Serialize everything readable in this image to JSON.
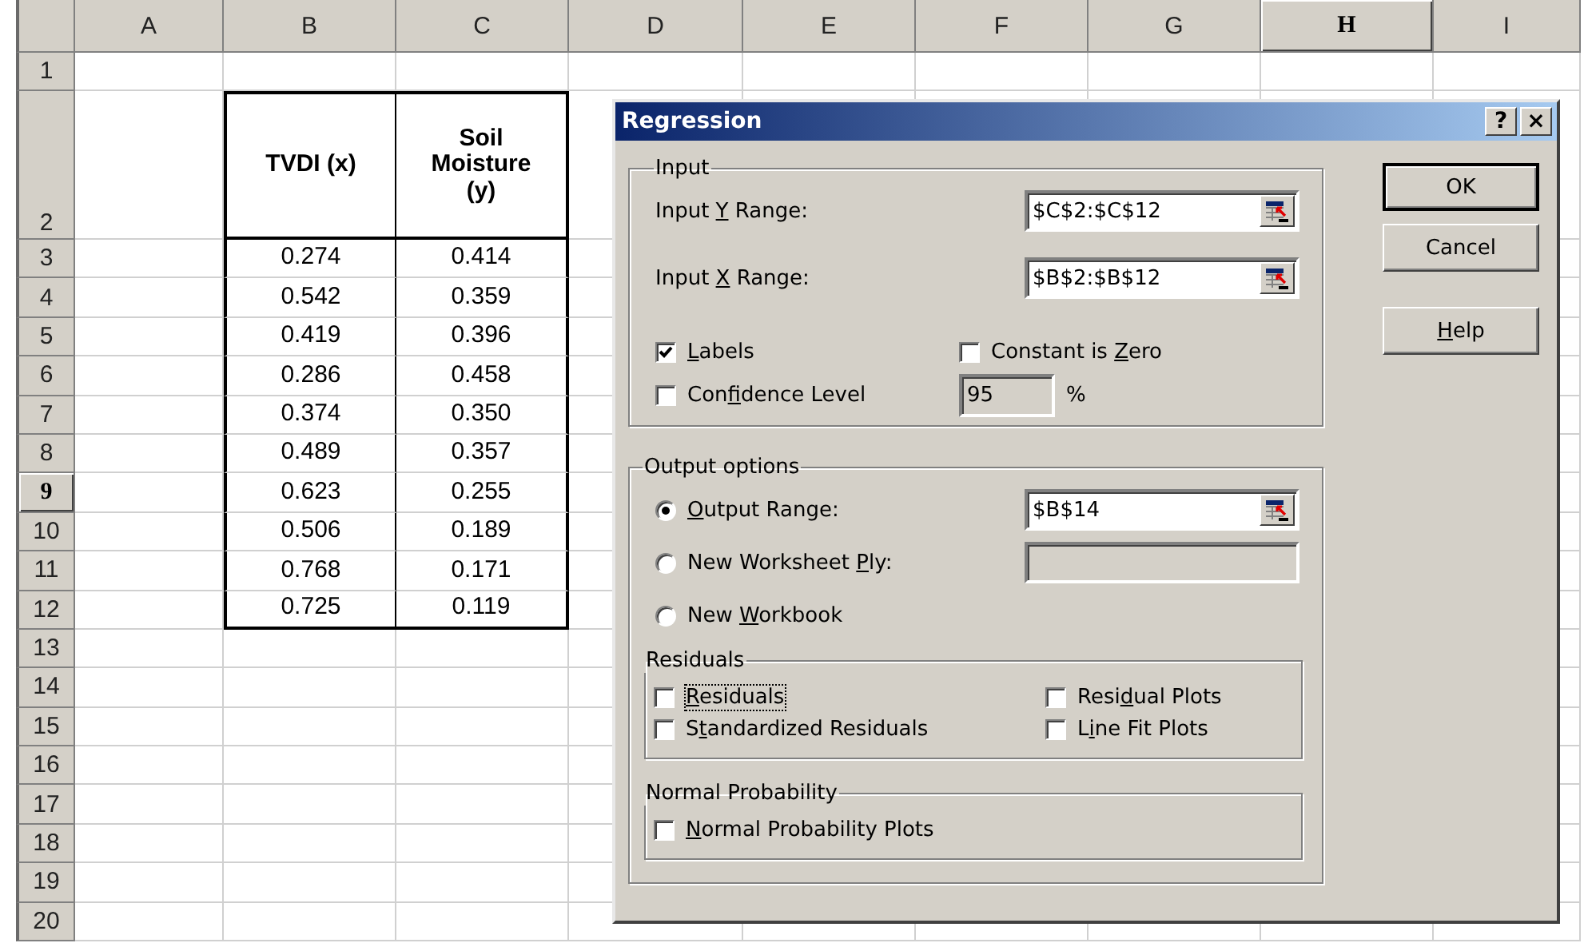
{
  "sheet": {
    "columns": [
      {
        "label": "A",
        "selected": false
      },
      {
        "label": "B",
        "selected": false
      },
      {
        "label": "C",
        "selected": false
      },
      {
        "label": "D",
        "selected": false
      },
      {
        "label": "E",
        "selected": false
      },
      {
        "label": "F",
        "selected": false
      },
      {
        "label": "G",
        "selected": false
      },
      {
        "label": "H",
        "selected": true
      },
      {
        "label": "I",
        "selected": false
      }
    ],
    "rows": [
      {
        "label": "1",
        "selected": false
      },
      {
        "label": "2",
        "selected": false
      },
      {
        "label": "3",
        "selected": false
      },
      {
        "label": "4",
        "selected": false
      },
      {
        "label": "5",
        "selected": false
      },
      {
        "label": "6",
        "selected": false
      },
      {
        "label": "7",
        "selected": false
      },
      {
        "label": "8",
        "selected": false
      },
      {
        "label": "9",
        "selected": true
      },
      {
        "label": "10",
        "selected": false
      },
      {
        "label": "11",
        "selected": false
      },
      {
        "label": "12",
        "selected": false
      },
      {
        "label": "13",
        "selected": false
      },
      {
        "label": "14",
        "selected": false
      },
      {
        "label": "15",
        "selected": false
      },
      {
        "label": "16",
        "selected": false
      },
      {
        "label": "17",
        "selected": false
      },
      {
        "label": "18",
        "selected": false
      },
      {
        "label": "19",
        "selected": false
      },
      {
        "label": "20",
        "selected": false
      }
    ],
    "table": {
      "headers": [
        "TVDI (x)",
        "Soil Moisture (y)"
      ],
      "rows": [
        [
          "0.274",
          "0.414"
        ],
        [
          "0.542",
          "0.359"
        ],
        [
          "0.419",
          "0.396"
        ],
        [
          "0.286",
          "0.458"
        ],
        [
          "0.374",
          "0.350"
        ],
        [
          "0.489",
          "0.357"
        ],
        [
          "0.623",
          "0.255"
        ],
        [
          "0.506",
          "0.189"
        ],
        [
          "0.768",
          "0.171"
        ],
        [
          "0.725",
          "0.119"
        ]
      ]
    }
  },
  "dialog": {
    "title": "Regression",
    "title_buttons": [
      "?",
      "×"
    ],
    "input": {
      "title": "Input",
      "fields": [
        {
          "label": [
            {
              "text": "Input ",
              "underlined": false
            },
            {
              "text": "Y",
              "underlined": true
            },
            {
              "text": " Range:",
              "underlined": false
            }
          ],
          "value": "$C$2:$C$12"
        },
        {
          "label": [
            {
              "text": "Input ",
              "underlined": false
            },
            {
              "text": "X",
              "underlined": true
            },
            {
              "text": " Range:",
              "underlined": false
            }
          ],
          "value": "$B$2:$B$12"
        }
      ],
      "labels": {
        "label": [
          {
            "text": "L",
            "underlined": true
          },
          {
            "text": "abels",
            "underlined": false
          }
        ],
        "checked": true
      },
      "constant": {
        "label": [
          {
            "text": "Constant is ",
            "underlined": false
          },
          {
            "text": "Z",
            "underlined": true
          },
          {
            "text": "ero",
            "underlined": false
          }
        ],
        "checked": false
      },
      "confidence": {
        "label": [
          {
            "text": "Con",
            "underlined": false
          },
          {
            "text": "f",
            "underlined": true
          },
          {
            "text": "idence Level",
            "underlined": false
          }
        ],
        "checked": false,
        "value": "95",
        "disabled": true,
        "unit": "%"
      }
    },
    "output": {
      "title": "Output options",
      "options": [
        {
          "label": [
            {
              "text": "O",
              "underlined": true
            },
            {
              "text": "utput Range:",
              "underlined": false
            }
          ],
          "selected": true,
          "value": "$B$14",
          "disabled": false
        },
        {
          "label": [
            {
              "text": "New Worksheet ",
              "underlined": false
            },
            {
              "text": "P",
              "underlined": true
            },
            {
              "text": "ly:",
              "underlined": false
            }
          ],
          "selected": false,
          "disabled": true
        },
        {
          "label": [
            {
              "text": "New ",
              "underlined": false
            },
            {
              "text": "W",
              "underlined": true
            },
            {
              "text": "orkbook",
              "underlined": false
            }
          ],
          "selected": false
        }
      ]
    },
    "residuals": {
      "title": "Residuals",
      "items": [
        {
          "label": [
            {
              "text": "R",
              "underlined": true
            },
            {
              "text": "esiduals",
              "underlined": false
            }
          ],
          "checked": false,
          "focused": true
        },
        {
          "label": [
            {
              "text": "Resi",
              "underlined": false
            },
            {
              "text": "d",
              "underlined": true
            },
            {
              "text": "ual Plots",
              "underlined": false
            }
          ],
          "checked": false,
          "focused": false
        },
        {
          "label": [
            {
              "text": "S",
              "underlined": false
            },
            {
              "text": "t",
              "underlined": true
            },
            {
              "text": "andardized Residuals",
              "underlined": false
            }
          ],
          "checked": false,
          "focused": false
        },
        {
          "label": [
            {
              "text": "L",
              "underlined": false
            },
            {
              "text": "i",
              "underlined": true
            },
            {
              "text": "ne Fit Plots",
              "underlined": false
            }
          ],
          "checked": false,
          "focused": false
        }
      ]
    },
    "normal": {
      "title": "Normal Probability",
      "items": [
        {
          "label": [
            {
              "text": "N",
              "underlined": true
            },
            {
              "text": "ormal Probability Plots",
              "underlined": false
            }
          ],
          "checked": false,
          "focused": false
        }
      ]
    },
    "buttons": [
      {
        "label": [
          {
            "text": "OK",
            "underlined": false
          }
        ],
        "default": true
      },
      {
        "label": [
          {
            "text": "Cancel",
            "underlined": false
          }
        ],
        "default": false
      },
      {
        "label": [
          {
            "text": "H",
            "underlined": true
          },
          {
            "text": "elp",
            "underlined": false
          }
        ],
        "default": false
      }
    ]
  }
}
